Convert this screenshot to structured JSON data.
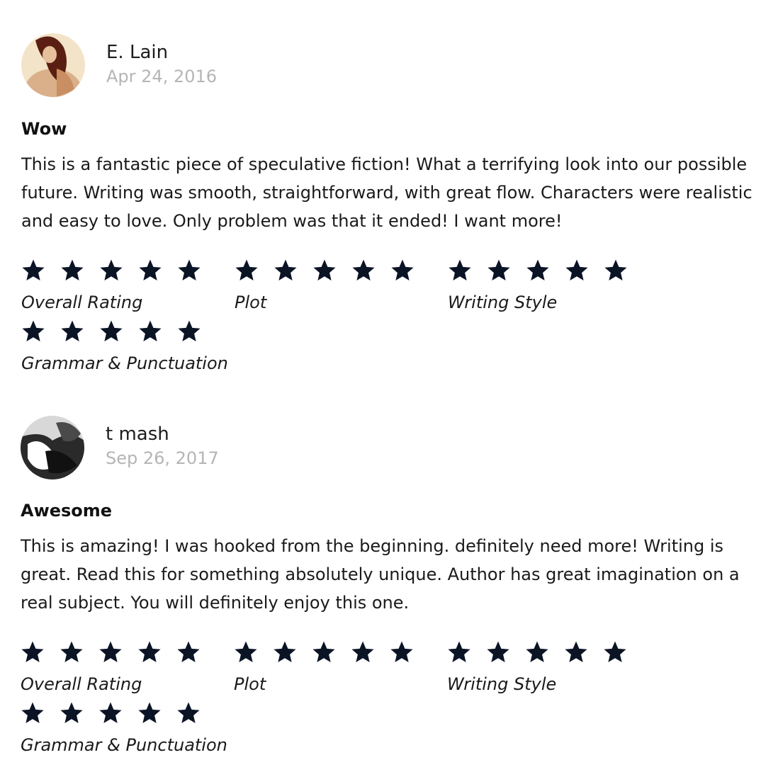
{
  "reviews": [
    {
      "name": "E. Lain",
      "date": "Apr 24, 2016",
      "title": "Wow",
      "body": "This is a fantastic piece of speculative fiction! What a terrifying look into our possible future. Writing was smooth, straightforward, with great flow. Characters were realistic and easy to love. Only problem was that it ended! I want more!",
      "ratings": [
        {
          "label": "Overall Rating",
          "stars": 5
        },
        {
          "label": "Plot",
          "stars": 5
        },
        {
          "label": "Writing Style",
          "stars": 5
        },
        {
          "label": "Grammar & Punctuation",
          "stars": 5
        }
      ]
    },
    {
      "name": "t mash",
      "date": "Sep 26, 2017",
      "title": "Awesome",
      "body": "This is amazing! I was hooked from the beginning. definitely need more! Writing is great. Read this for something absolutely unique. Author has great imagination on a real subject. You will definitely enjoy this one.",
      "ratings": [
        {
          "label": "Overall Rating",
          "stars": 5
        },
        {
          "label": "Plot",
          "stars": 5
        },
        {
          "label": "Writing Style",
          "stars": 5
        },
        {
          "label": "Grammar & Punctuation",
          "stars": 5
        }
      ]
    }
  ],
  "colors": {
    "star": "#0b1425",
    "date": "#b5b5b5"
  }
}
